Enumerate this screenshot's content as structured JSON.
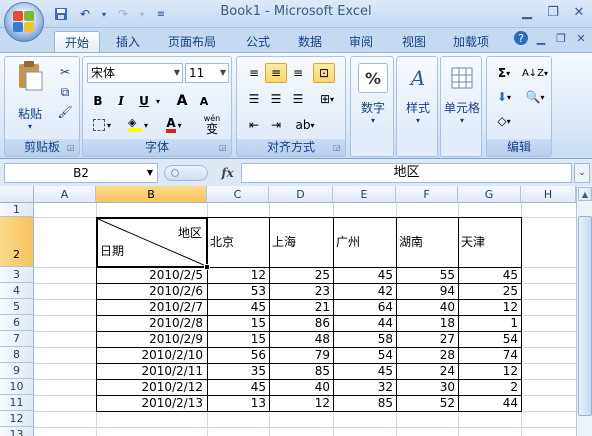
{
  "window": {
    "title": "Book1 - Microsoft Excel"
  },
  "tabs": [
    "开始",
    "插入",
    "页面布局",
    "公式",
    "数据",
    "审阅",
    "视图",
    "加载项"
  ],
  "ribbon": {
    "clipboard": {
      "paste_label": "粘贴",
      "group_label": "剪贴板"
    },
    "font": {
      "name": "宋体",
      "size": "11",
      "group_label": "字体",
      "bold": "B",
      "italic": "I",
      "underline": "U",
      "grow": "A",
      "shrink": "A",
      "wen": "变"
    },
    "alignment": {
      "group_label": "对齐方式"
    },
    "number": {
      "label": "数字",
      "icon_text": "%"
    },
    "styles": {
      "label": "样式",
      "icon_text": "A"
    },
    "cells": {
      "label": "单元格"
    },
    "editing": {
      "group_label": "编辑",
      "sum": "Σ"
    }
  },
  "formula_bar": {
    "name_box": "B2",
    "fx": "fx",
    "value": "地区"
  },
  "grid": {
    "columns": [
      "A",
      "B",
      "C",
      "D",
      "E",
      "F",
      "G",
      "H"
    ],
    "active_column": "B",
    "rows": [
      "1",
      "2",
      "3",
      "4",
      "5",
      "6",
      "7",
      "8",
      "9",
      "10",
      "11",
      "12",
      "13"
    ],
    "active_row": "2",
    "header_diag": {
      "top_right": "地区",
      "bottom_left": "日期"
    },
    "headers": [
      "北京",
      "上海",
      "广州",
      "湖南",
      "天津"
    ],
    "data": [
      {
        "date": "2010/2/5",
        "values": [
          "12",
          "25",
          "45",
          "55",
          "45"
        ]
      },
      {
        "date": "2010/2/6",
        "values": [
          "53",
          "23",
          "42",
          "94",
          "25"
        ]
      },
      {
        "date": "2010/2/7",
        "values": [
          "45",
          "21",
          "64",
          "40",
          "12"
        ]
      },
      {
        "date": "2010/2/8",
        "values": [
          "15",
          "86",
          "44",
          "18",
          "1"
        ]
      },
      {
        "date": "2010/2/9",
        "values": [
          "15",
          "48",
          "58",
          "27",
          "54"
        ]
      },
      {
        "date": "2010/2/10",
        "values": [
          "56",
          "79",
          "54",
          "28",
          "74"
        ]
      },
      {
        "date": "2010/2/11",
        "values": [
          "35",
          "85",
          "45",
          "24",
          "12"
        ]
      },
      {
        "date": "2010/2/12",
        "values": [
          "45",
          "40",
          "32",
          "30",
          "2"
        ]
      },
      {
        "date": "2010/2/13",
        "values": [
          "13",
          "12",
          "85",
          "52",
          "44"
        ]
      }
    ]
  },
  "colors": {
    "accent": "#15428b",
    "selected": "#f8c35e",
    "ribbon_bg": "#dbe8f7"
  }
}
